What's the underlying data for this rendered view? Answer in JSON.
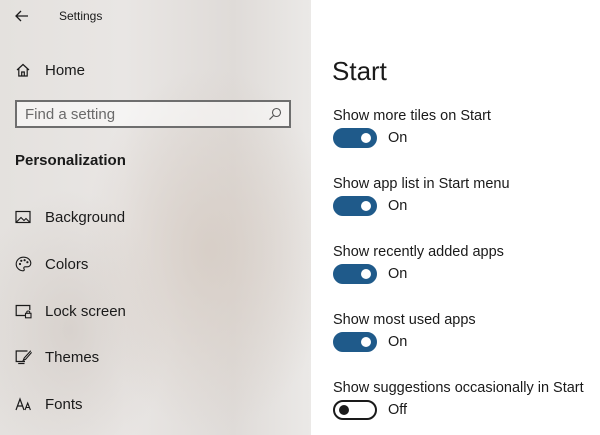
{
  "window": {
    "title": "Settings"
  },
  "sidebar": {
    "home_label": "Home",
    "search": {
      "placeholder": "Find a setting"
    },
    "section": "Personalization",
    "items": [
      {
        "label": "Background",
        "icon": "image-icon"
      },
      {
        "label": "Colors",
        "icon": "palette-icon"
      },
      {
        "label": "Lock screen",
        "icon": "lock-screen-icon"
      },
      {
        "label": "Themes",
        "icon": "themes-icon"
      },
      {
        "label": "Fonts",
        "icon": "fonts-icon"
      }
    ]
  },
  "main": {
    "title": "Start",
    "settings": [
      {
        "label": "Show more tiles on Start",
        "state": "On"
      },
      {
        "label": "Show app list in Start menu",
        "state": "On"
      },
      {
        "label": "Show recently added apps",
        "state": "On"
      },
      {
        "label": "Show most used apps",
        "state": "On"
      },
      {
        "label": "Show suggestions occasionally in Start",
        "state": "Off"
      }
    ]
  },
  "colors": {
    "toggle_on": "#1f5a8a",
    "toggle_off_border": "#1a1a1a"
  }
}
